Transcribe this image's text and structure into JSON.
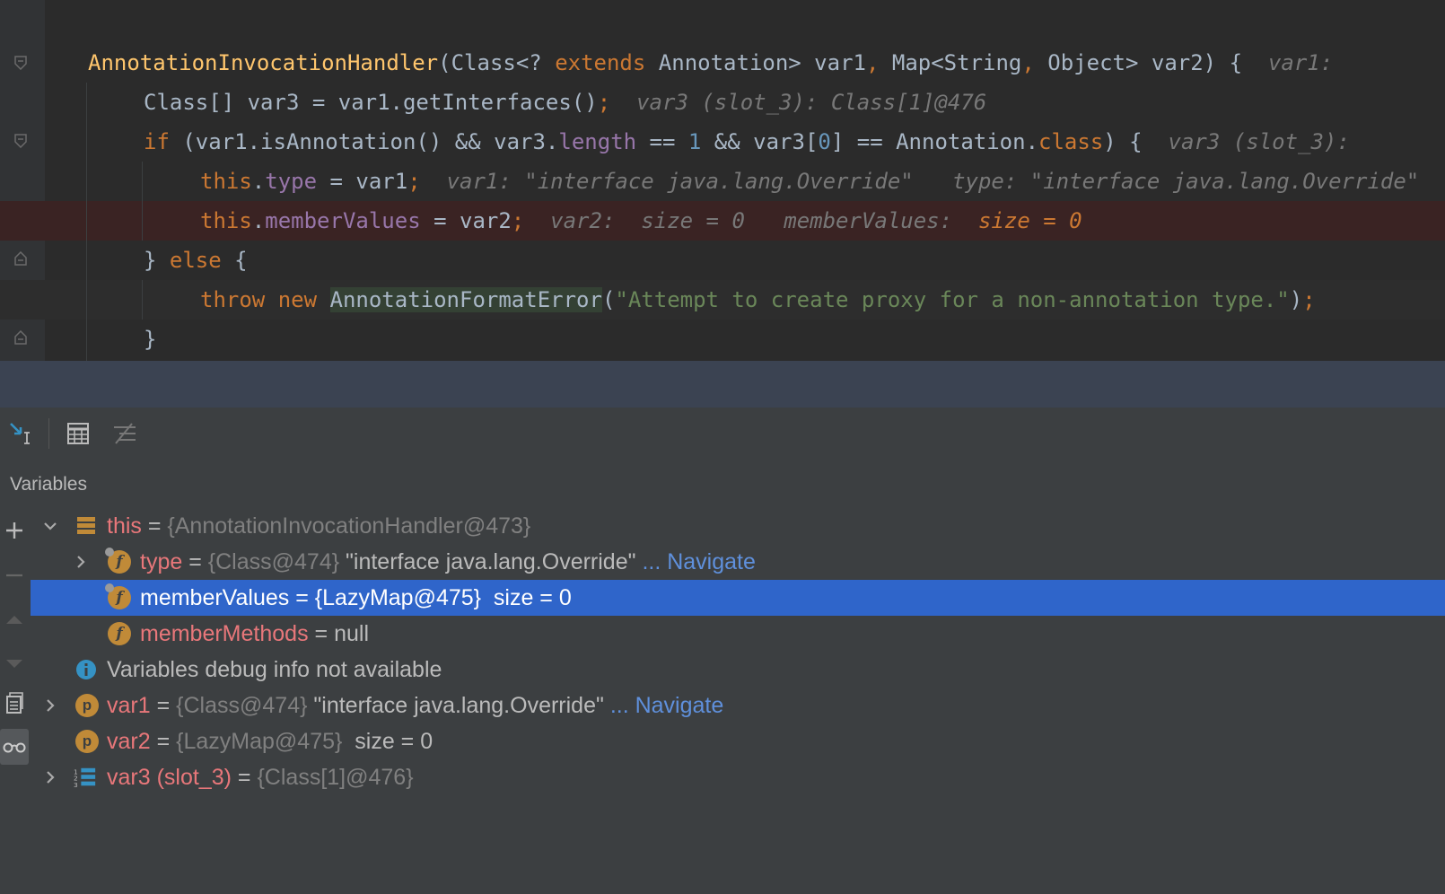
{
  "editor": {
    "lines": [
      [
        {
          "t": "AnnotationInvocationHandler",
          "c": "fn"
        },
        {
          "t": "(Class<? ",
          "c": ""
        },
        {
          "t": "extends",
          "c": "kw"
        },
        {
          "t": " Annotation> var1",
          "c": ""
        },
        {
          "t": ",",
          "c": "kw"
        },
        {
          "t": " Map<String",
          "c": ""
        },
        {
          "t": ",",
          "c": "kw"
        },
        {
          "t": " Object> var2) {  ",
          "c": ""
        },
        {
          "t": "var1:",
          "c": "hint"
        }
      ],
      [
        {
          "t": "Class[] var3 = var1.getInterfaces()",
          "c": ""
        },
        {
          "t": ";",
          "c": "kw"
        },
        {
          "t": "  ",
          "c": ""
        },
        {
          "t": "var3 (slot_3): Class[1]@476",
          "c": "hint"
        }
      ],
      [
        {
          "t": "if",
          "c": "kw"
        },
        {
          "t": " (var1.isAnnotation() && var3.",
          "c": ""
        },
        {
          "t": "length",
          "c": "fld"
        },
        {
          "t": " == ",
          "c": ""
        },
        {
          "t": "1",
          "c": "num"
        },
        {
          "t": " && var3[",
          "c": ""
        },
        {
          "t": "0",
          "c": "num"
        },
        {
          "t": "] == Annotation.",
          "c": ""
        },
        {
          "t": "class",
          "c": "kw"
        },
        {
          "t": ") {  ",
          "c": ""
        },
        {
          "t": "var3 (slot_3):",
          "c": "hint"
        }
      ],
      [
        {
          "t": "this",
          "c": "kw"
        },
        {
          "t": ".",
          "c": ""
        },
        {
          "t": "type",
          "c": "fld"
        },
        {
          "t": " = var1",
          "c": ""
        },
        {
          "t": ";",
          "c": "kw"
        },
        {
          "t": "  ",
          "c": ""
        },
        {
          "t": "var1: \"interface java.lang.Override\"   type: \"interface java.lang.Override\"",
          "c": "hint"
        }
      ],
      [
        {
          "t": "this",
          "c": "kw"
        },
        {
          "t": ".",
          "c": ""
        },
        {
          "t": "memberValues",
          "c": "fld"
        },
        {
          "t": " = var2",
          "c": ""
        },
        {
          "t": ";",
          "c": "kw"
        },
        {
          "t": "  ",
          "c": ""
        },
        {
          "t": "var2:  size = 0   memberValues:  ",
          "c": "hint"
        },
        {
          "t": "size = 0",
          "c": "hint-hl"
        }
      ],
      [
        {
          "t": "} ",
          "c": ""
        },
        {
          "t": "else",
          "c": "kw"
        },
        {
          "t": " {",
          "c": ""
        }
      ],
      [
        {
          "t": "throw new",
          "c": "kw"
        },
        {
          "t": " ",
          "c": ""
        },
        {
          "t": "AnnotationFormatError",
          "c": "exc"
        },
        {
          "t": "(",
          "c": ""
        },
        {
          "t": "\"Attempt to create proxy for a non-annotation type.\"",
          "c": "str"
        },
        {
          "t": ")",
          "c": ""
        },
        {
          "t": ";",
          "c": "kw"
        }
      ],
      [
        {
          "t": "}",
          "c": ""
        }
      ]
    ]
  },
  "toolbar": {
    "icons": [
      "cursor-to-line-icon",
      "table-icon",
      "tree-list-icon"
    ]
  },
  "variables_panel": {
    "title": "Variables"
  },
  "tree": {
    "rows": [
      {
        "name": "this",
        "eq": " = ",
        "value": "{AnnotationInvocationHandler@473}",
        "extra": "",
        "link": ""
      },
      {
        "name": "type",
        "eq": " = ",
        "value": "{Class@474}",
        "extra": " \"interface java.lang.Override\"",
        "link": " ... Navigate"
      },
      {
        "name": "memberValues",
        "eq": " = ",
        "value": "{LazyMap@475}",
        "extra": "  size = 0",
        "link": ""
      },
      {
        "name": "memberMethods",
        "eq": " = ",
        "value": "null",
        "extra": "",
        "link": ""
      },
      {
        "info": "Variables debug info not available"
      },
      {
        "name": "var1",
        "eq": " = ",
        "value": "{Class@474}",
        "extra": " \"interface java.lang.Override\"",
        "link": " ... Navigate"
      },
      {
        "name": "var2",
        "eq": " = ",
        "value": "{LazyMap@475}",
        "extra": "  size = 0",
        "link": ""
      },
      {
        "name": "var3 (slot_3)",
        "eq": " = ",
        "value": "{Class[1]@476}",
        "extra": "",
        "link": ""
      }
    ],
    "badge_field": "f",
    "badge_param": "p"
  }
}
